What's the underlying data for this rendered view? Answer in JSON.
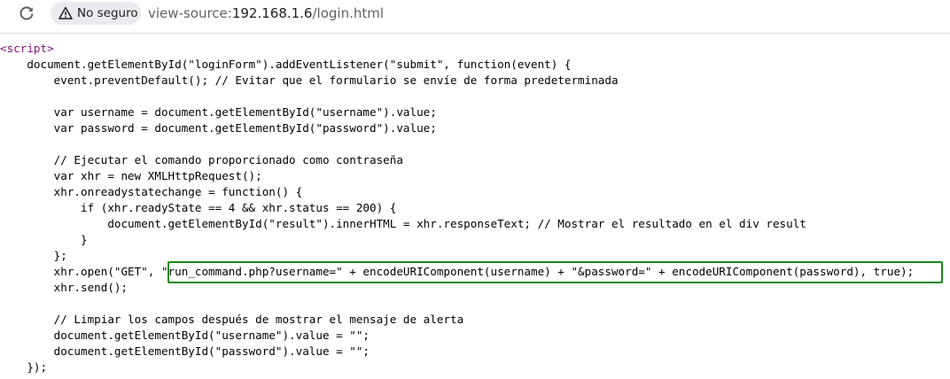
{
  "browser": {
    "reload_icon": "reload-icon",
    "security_badge": {
      "icon": "warning-triangle-icon",
      "label": "No seguro"
    },
    "address": {
      "scheme": "view-source:",
      "host": "192.168.1.6",
      "path": "/login.html"
    }
  },
  "source_lines": [
    "<script>",
    "    document.getElementById(\"loginForm\").addEventListener(\"submit\", function(event) {",
    "        event.preventDefault(); // Evitar que el formulario se envíe de forma predeterminada",
    "",
    "        var username = document.getElementById(\"username\").value;",
    "        var password = document.getElementById(\"password\").value;",
    "",
    "        // Ejecutar el comando proporcionado como contraseña",
    "        var xhr = new XMLHttpRequest();",
    "        xhr.onreadystatechange = function() {",
    "            if (xhr.readyState == 4 && xhr.status == 200) {",
    "                document.getElementById(\"result\").innerHTML = xhr.responseText; // Mostrar el resultado en el div result",
    "            }",
    "        };",
    "        xhr.open(\"GET\", \"run_command.php?username=\" + encodeURIComponent(username) + \"&password=\" + encodeURIComponent(password), true);",
    "        xhr.send();",
    "",
    "        // Limpiar los campos después de mostrar el mensaje de alerta",
    "        document.getElementById(\"username\").value = \"\";",
    "        document.getElementById(\"password\").value = \"\";",
    "    });"
  ],
  "colors": {
    "tag": "#881280",
    "highlight_border": "#1a8b1a",
    "badge_bg": "#e9ebee"
  }
}
